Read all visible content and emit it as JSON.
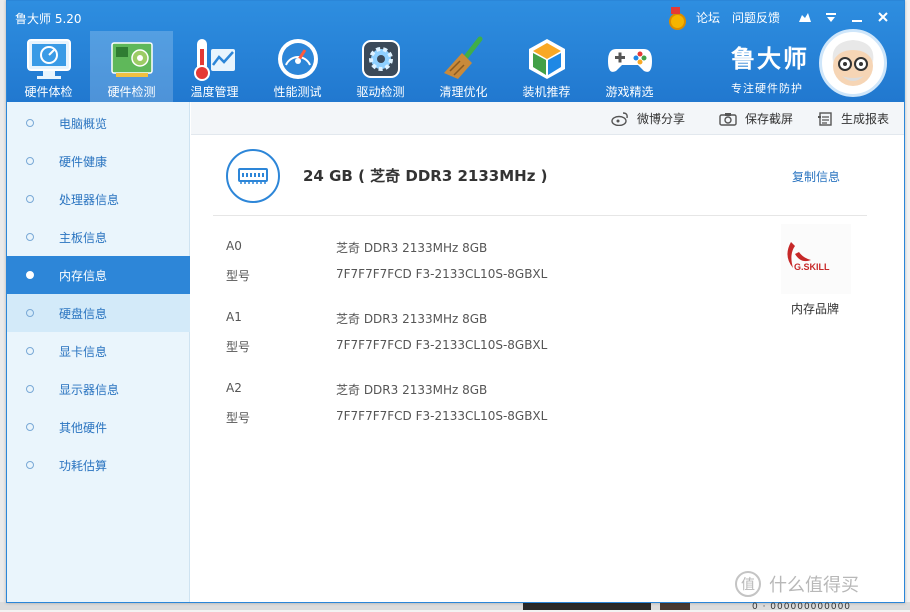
{
  "app": {
    "title": "鲁大师 5.20"
  },
  "title_links": {
    "forum": "论坛",
    "feedback": "问题反馈"
  },
  "nav": [
    {
      "label": "硬件体检",
      "icon": "monitor-icon"
    },
    {
      "label": "硬件检测",
      "icon": "circuit-board-icon"
    },
    {
      "label": "温度管理",
      "icon": "thermometer-icon"
    },
    {
      "label": "性能测试",
      "icon": "speedometer-icon"
    },
    {
      "label": "驱动检测",
      "icon": "gear-icon"
    },
    {
      "label": "清理优化",
      "icon": "broom-icon"
    },
    {
      "label": "装机推荐",
      "icon": "cube-icon"
    },
    {
      "label": "游戏精选",
      "icon": "gamepad-icon"
    }
  ],
  "brand": {
    "name": "鲁大师",
    "slogan": "专注硬件防护"
  },
  "sidebar": [
    {
      "label": "电脑概览"
    },
    {
      "label": "硬件健康"
    },
    {
      "label": "处理器信息"
    },
    {
      "label": "主板信息"
    },
    {
      "label": "内存信息"
    },
    {
      "label": "硬盘信息"
    },
    {
      "label": "显卡信息"
    },
    {
      "label": "显示器信息"
    },
    {
      "label": "其他硬件"
    },
    {
      "label": "功耗估算"
    }
  ],
  "toolbar": {
    "share": "微博分享",
    "screenshot": "保存截屏",
    "report": "生成报表"
  },
  "memory": {
    "summary": "24 GB ( 芝奇 DDR3 2133MHz )",
    "copy": "复制信息",
    "slots": [
      {
        "slot": "A0",
        "desc": "芝奇 DDR3 2133MHz 8GB",
        "model_label": "型号",
        "model": "7F7F7F7FCD F3-2133CL10S-8GBXL"
      },
      {
        "slot": "A1",
        "desc": "芝奇 DDR3 2133MHz 8GB",
        "model_label": "型号",
        "model": "7F7F7F7FCD F3-2133CL10S-8GBXL"
      },
      {
        "slot": "A2",
        "desc": "芝奇 DDR3 2133MHz 8GB",
        "model_label": "型号",
        "model": "7F7F7F7FCD F3-2133CL10S-8GBXL"
      }
    ],
    "brand_logo": "G.SKILL",
    "brand_caption": "内存品牌"
  },
  "watermark": "什么值得买",
  "colors": {
    "accent": "#2d86d8",
    "sidebar_bg": "#eaf5fc",
    "link": "#2a74c0"
  }
}
